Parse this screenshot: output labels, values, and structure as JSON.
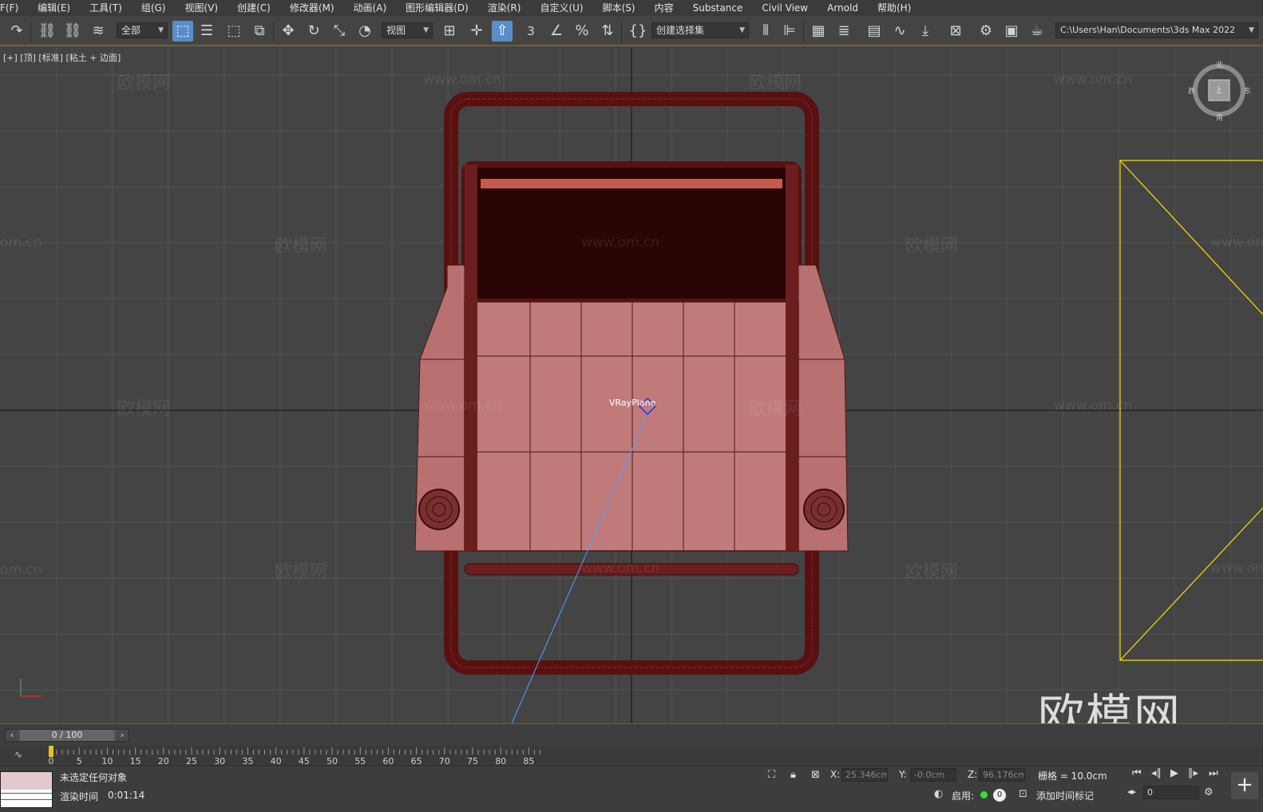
{
  "menu": {
    "items": [
      "F(F)",
      "编辑(E)",
      "工具(T)",
      "组(G)",
      "视图(V)",
      "创建(C)",
      "修改器(M)",
      "动画(A)",
      "图形编辑器(D)",
      "渲染(R)",
      "自定义(U)",
      "脚本(S)",
      "内容",
      "Substance",
      "Civil View",
      "Arnold",
      "帮助(H)"
    ]
  },
  "toolbar": {
    "filter_label": "全部",
    "refcoord_label": "视图",
    "selection_set_placeholder": "创建选择集",
    "path_label": "C:\\Users\\Han\\Documents\\3ds Max 2022",
    "spinner_snap_label": "3",
    "icons": [
      "redo-icon",
      "link-icon",
      "unlink-icon",
      "bind-spacewarp-icon",
      "select-object-icon",
      "select-by-name-icon",
      "rect-region-icon",
      "window-crossing-icon",
      "move-icon",
      "rotate-icon",
      "scale-icon",
      "placement-icon",
      "use-pivot-icon",
      "manipulate-icon",
      "keyboard-shortcut-icon",
      "snap-3d-icon",
      "angle-snap-icon",
      "percent-snap-icon",
      "spinner-snap-icon",
      "edit-named-sets-icon",
      "mirror-icon",
      "align-icon",
      "scene-explorer-icon",
      "layer-explorer-icon",
      "toggle-ribbon-icon",
      "curve-editor-icon",
      "schematic-icon",
      "material-editor-icon",
      "render-setup-icon",
      "rendered-frame-icon",
      "render-icon"
    ]
  },
  "viewport": {
    "label": "[+] [顶] [标准] [粘土 + 边面]",
    "object_label": "VRayPlane",
    "watermark_text": "欧模网",
    "watermark_url": "www.om.cn",
    "watermark_url_partial": "om.cn",
    "big_watermark": "欧模网",
    "viewcube": {
      "north": "北",
      "west": "西",
      "east": "东",
      "south": "南",
      "face": "上"
    },
    "colors": {
      "background": "#444444",
      "grid": "#5a5a5a",
      "axis": "#1c1c1c",
      "model": "#c07a7a",
      "wire": "#4a1515",
      "frame": "#6b1e1e",
      "camera_target": "#4ea3ff",
      "selection_outline": "#ffe000"
    }
  },
  "timeline": {
    "position": "0 / 100",
    "ticks": [
      "0",
      "5",
      "10",
      "15",
      "20",
      "25",
      "30",
      "35",
      "40",
      "45",
      "50",
      "55",
      "60",
      "65",
      "70",
      "75",
      "80",
      "85"
    ]
  },
  "status": {
    "selection_text": "未选定任何对象",
    "render_time_label": "渲染时间",
    "render_time_value": "0:01:14",
    "x_label": "X:",
    "x_value": "25.346cm",
    "y_label": "Y:",
    "y_value": "-0.0cm",
    "z_label": "Z:",
    "z_value": "96.176cm",
    "grid_label": "栅格 = 10.0cm",
    "enable_label": "启用:",
    "enable_count": "0",
    "add_time_tag": "添加时间标记",
    "frame_value": "0"
  }
}
